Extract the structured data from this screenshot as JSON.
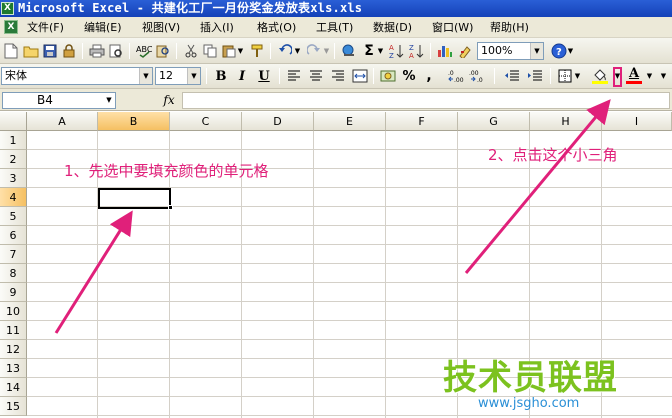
{
  "window": {
    "app_icon_letter": "X",
    "title": "Microsoft Excel - 共建化工厂一月份奖金发放表xls.xls"
  },
  "menu": {
    "app_icon_letter": "X",
    "items": [
      "文件(F)",
      "编辑(E)",
      "视图(V)",
      "插入(I)",
      "格式(O)",
      "工具(T)",
      "数据(D)",
      "窗口(W)",
      "帮助(H)"
    ]
  },
  "standard_toolbar": {
    "zoom_value": "100%",
    "autosum_symbol": "Σ"
  },
  "format_toolbar": {
    "font_name": "宋体",
    "font_size": "12",
    "bold_label": "B",
    "italic_label": "I",
    "underline_label": "U",
    "percent_label": "%",
    "comma_label": ",",
    "font_color_label": "A",
    "fill_color": "#ffff00",
    "font_color": "#ff0000"
  },
  "formula_bar": {
    "name_box_value": "B4",
    "fx_label": "fx",
    "formula_value": ""
  },
  "sheet": {
    "columns": [
      "A",
      "B",
      "C",
      "D",
      "E",
      "F",
      "G",
      "H",
      "I"
    ],
    "rows": [
      "1",
      "2",
      "3",
      "4",
      "5",
      "6",
      "7",
      "8",
      "9",
      "10",
      "11",
      "12",
      "13",
      "14",
      "15"
    ],
    "active_cell": "B4",
    "selected_column": "B",
    "selected_row": "4"
  },
  "annotations": {
    "note1": "1、先选中要填充颜色的单元格",
    "note2": "2、点击这个小三角",
    "color": "#e0207a"
  },
  "watermark": {
    "title": "技术员联盟",
    "url": "www.jsgho.com"
  }
}
